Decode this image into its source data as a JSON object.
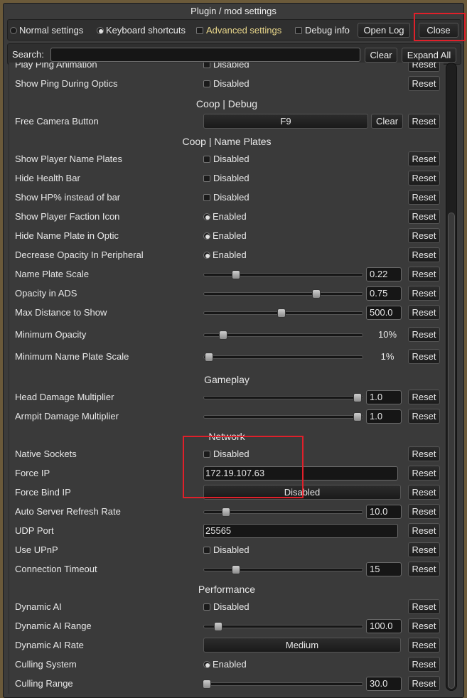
{
  "window": {
    "title": "Plugin / mod settings"
  },
  "toolbar": {
    "normal_settings": "Normal settings",
    "keyboard_shortcuts": "Keyboard shortcuts",
    "advanced_settings": "Advanced settings",
    "debug_info": "Debug info",
    "open_log": "Open Log",
    "close": "Close"
  },
  "search": {
    "label": "Search:",
    "value": "",
    "clear": "Clear",
    "expand_all": "Expand All"
  },
  "reset_label": "Reset",
  "clear_label": "Clear",
  "sections": {
    "coop_debug": "Coop | Debug",
    "coop_name_plates": "Coop | Name Plates",
    "gameplay": "Gameplay",
    "network": "Network",
    "performance": "Performance"
  },
  "rows": {
    "play_ping_animation": {
      "label": "Play Ping Animation",
      "value": "Disabled"
    },
    "show_ping_during_optics": {
      "label": "Show Ping During Optics",
      "value": "Disabled"
    },
    "free_camera_button": {
      "label": "Free Camera Button",
      "value": "F9"
    },
    "show_player_name_plates": {
      "label": "Show Player Name Plates",
      "value": "Disabled"
    },
    "hide_health_bar": {
      "label": "Hide Health Bar",
      "value": "Disabled"
    },
    "show_hp_percent": {
      "label": "Show HP% instead of bar",
      "value": "Disabled"
    },
    "show_player_faction_icon": {
      "label": "Show Player Faction Icon",
      "value": "Enabled"
    },
    "hide_name_plate_in_optic": {
      "label": "Hide Name Plate in Optic",
      "value": "Enabled"
    },
    "decrease_opacity_peripheral": {
      "label": "Decrease Opacity In Peripheral",
      "value": "Enabled"
    },
    "name_plate_scale": {
      "label": "Name Plate Scale",
      "value": "0.22",
      "level": 0.2
    },
    "opacity_in_ads": {
      "label": "Opacity in ADS",
      "value": "0.75",
      "level": 0.71
    },
    "max_distance_to_show": {
      "label": "Max Distance to Show",
      "value": "500.0",
      "level": 0.49
    },
    "minimum_opacity": {
      "label": "Minimum Opacity",
      "value": "10%",
      "level": 0.12
    },
    "minimum_name_plate_scale": {
      "label": "Minimum Name Plate Scale",
      "value": "1%",
      "level": 0.03
    },
    "head_damage_multiplier": {
      "label": "Head Damage Multiplier",
      "value": "1.0",
      "level": 0.97
    },
    "armpit_damage_multiplier": {
      "label": "Armpit Damage Multiplier",
      "value": "1.0",
      "level": 0.97
    },
    "native_sockets": {
      "label": "Native Sockets",
      "value": "Disabled"
    },
    "force_ip": {
      "label": "Force IP",
      "value": "172.19.107.63"
    },
    "force_bind_ip": {
      "label": "Force Bind IP",
      "value": "Disabled"
    },
    "auto_server_refresh_rate": {
      "label": "Auto Server Refresh Rate",
      "value": "10.0",
      "level": 0.14
    },
    "udp_port": {
      "label": "UDP Port",
      "value": "25565"
    },
    "use_upnp": {
      "label": "Use UPnP",
      "value": "Disabled"
    },
    "connection_timeout": {
      "label": "Connection Timeout",
      "value": "15",
      "level": 0.2
    },
    "dynamic_ai": {
      "label": "Dynamic AI",
      "value": "Disabled"
    },
    "dynamic_ai_range": {
      "label": "Dynamic AI Range",
      "value": "100.0",
      "level": 0.09
    },
    "dynamic_ai_rate": {
      "label": "Dynamic AI Rate",
      "value": "Medium"
    },
    "culling_system": {
      "label": "Culling System",
      "value": "Enabled"
    },
    "culling_range": {
      "label": "Culling Range",
      "value": "30.0",
      "level": 0.02
    }
  },
  "colors": {
    "advanced_settings_text": "#e8d68a",
    "highlight_box": "#e0202a"
  }
}
